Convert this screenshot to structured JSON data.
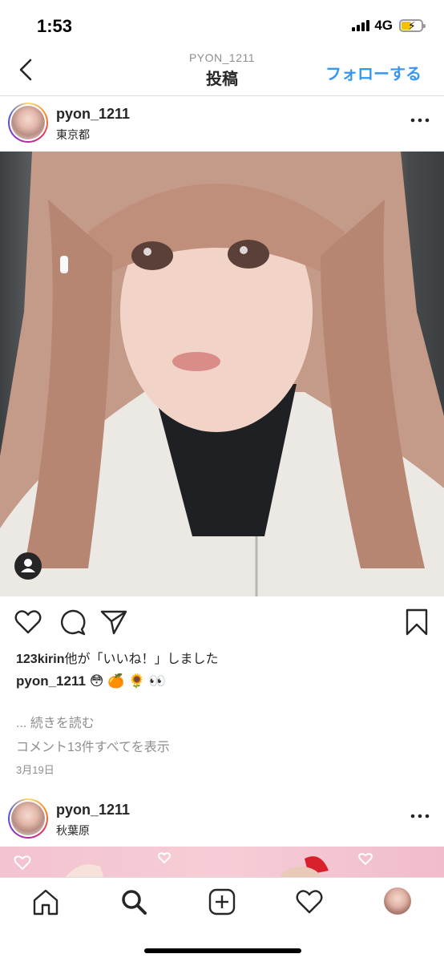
{
  "status_bar": {
    "time": "1:53",
    "network": "4G",
    "battery_color": "#f2c200"
  },
  "nav": {
    "back_icon": "chevron-left-icon",
    "subtitle": "PYON_1211",
    "title": "投稿",
    "follow_label": "フォローする",
    "follow_color": "#3897f0"
  },
  "post": {
    "username": "pyon_1211",
    "location": "東京都",
    "more_icon": "more-horizontal-icon",
    "liked_by_user": "123kirin",
    "liked_by_suffix": "他が「いいね！」しました",
    "caption_user": "pyon_1211",
    "caption_text": "😳 🍊 🌻 👀",
    "read_more": "... 続きを読む",
    "view_comments": "コメント13件すべてを表示",
    "date": "3月19日"
  },
  "next_post": {
    "username": "pyon_1211",
    "location": "秋葉原"
  },
  "tab_bar": {
    "items": [
      "home-icon",
      "search-icon",
      "new-post-icon",
      "activity-heart-icon",
      "profile-avatar"
    ]
  }
}
